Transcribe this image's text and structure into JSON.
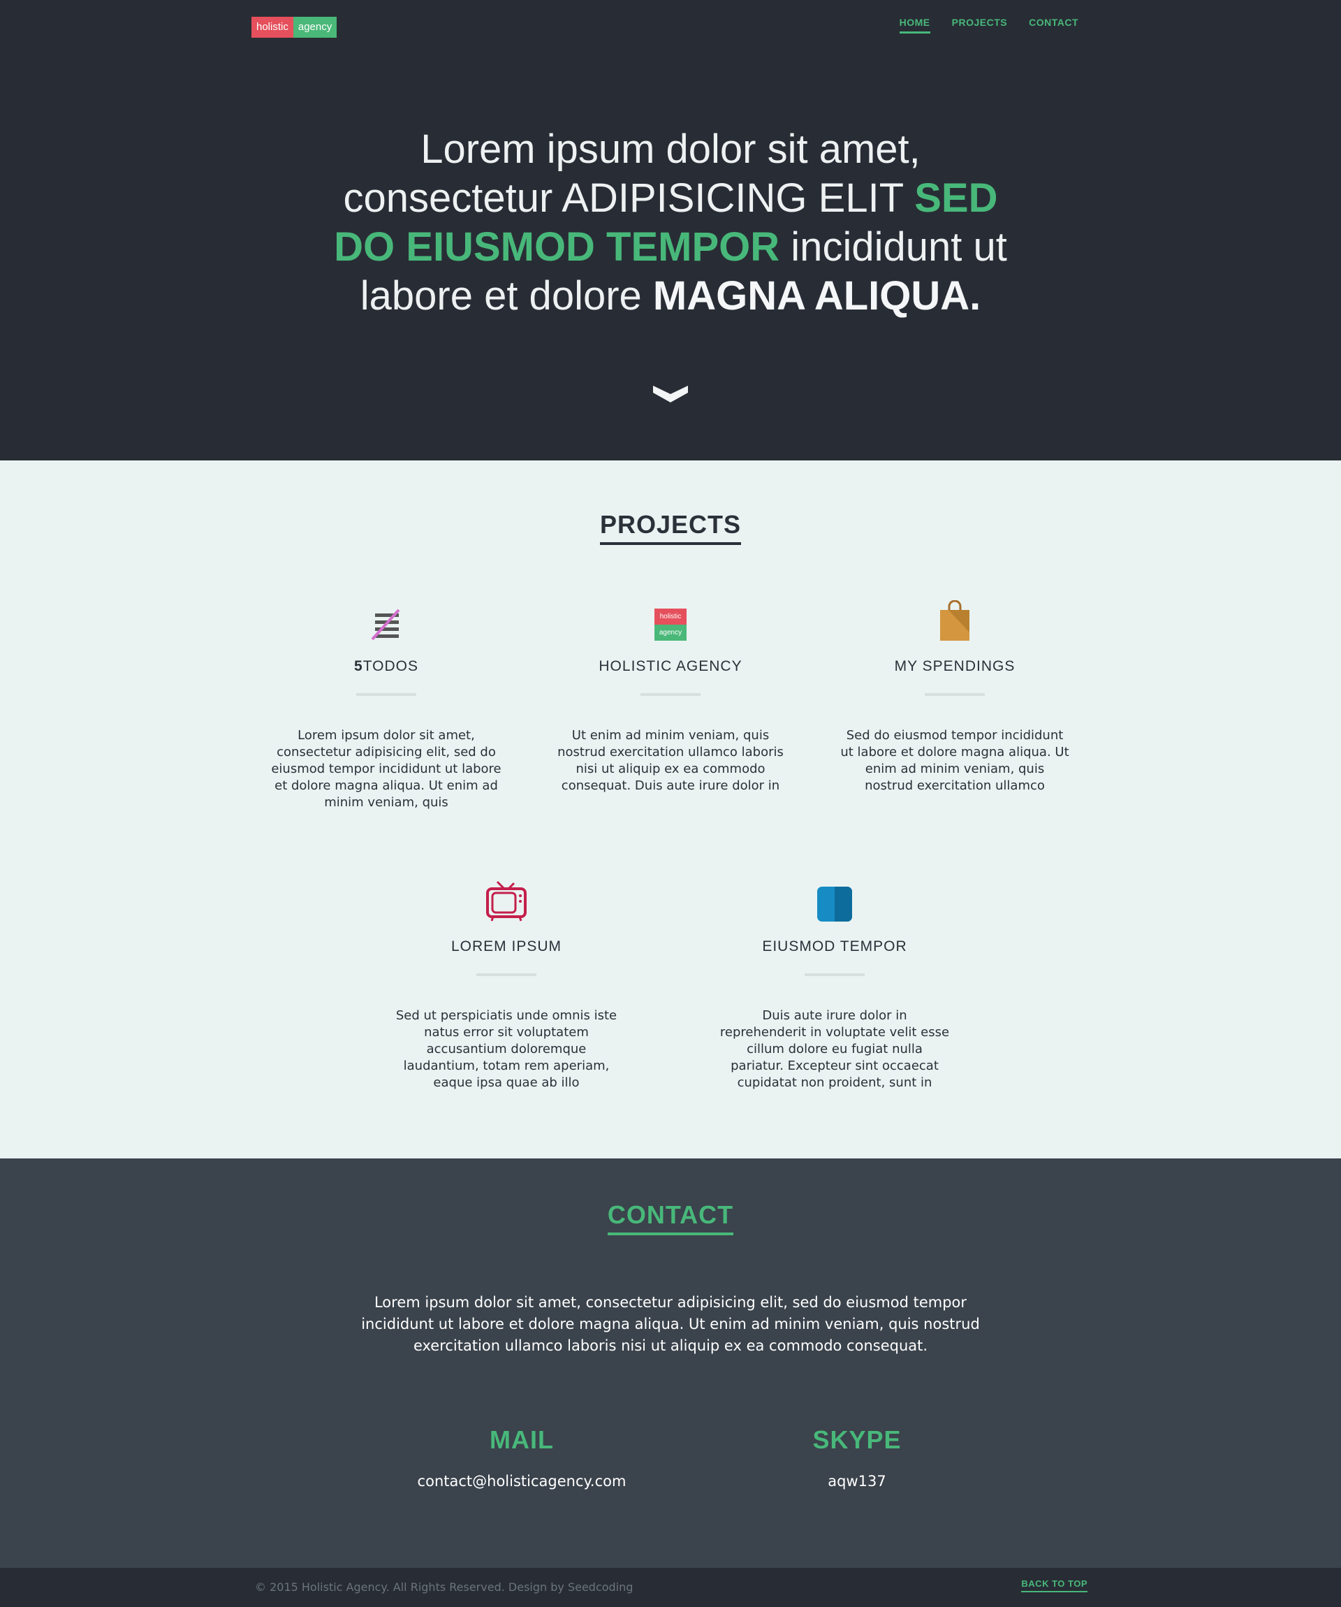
{
  "header": {
    "logo": {
      "part1": "holistic",
      "part2": "agency"
    },
    "nav": [
      {
        "label": "HOME"
      },
      {
        "label": "PROJECTS"
      },
      {
        "label": "CONTACT"
      }
    ]
  },
  "hero": {
    "line1": "Lorem ipsum dolor sit amet,",
    "line2_plain": "consectetur ADIPISICING ELIT",
    "line2_green": "SED",
    "line3_green": "DO EIUSMOD TEMPOR",
    "line3_plain": "incididunt ut",
    "line4_plain": "labore et dolore",
    "line4_bold": "MAGNA ALIQUA.",
    "scroll_icon": "chevron-down-icon"
  },
  "projects": {
    "title": "PROJECTS",
    "items": [
      {
        "name_prefix": "5",
        "name": "TODOS",
        "icon": "todo-list-icon",
        "desc": "Lorem ipsum dolor sit amet, consectetur adipisicing elit, sed do eiusmod tempor incididunt ut labore et dolore magna aliqua. Ut enim ad minim veniam, quis"
      },
      {
        "name_prefix": "",
        "name": "HOLISTIC AGENCY",
        "icon": "holistic-logo-icon",
        "icon_text1": "holistic",
        "icon_text2": "agency",
        "desc": "Ut enim ad minim veniam, quis nostrud exercitation ullamco laboris nisi ut aliquip ex ea commodo consequat. Duis aute irure dolor in"
      },
      {
        "name_prefix": "",
        "name": "MY SPENDINGS",
        "icon": "shopping-bag-icon",
        "desc": "Sed do eiusmod tempor incididunt ut labore et dolore magna aliqua. Ut enim ad minim veniam, quis nostrud exercitation ullamco"
      },
      {
        "name_prefix": "",
        "name": "LOREM IPSUM",
        "icon": "tv-icon",
        "desc": "Sed ut perspiciatis unde omnis iste natus error sit voluptatem accusantium doloremque laudantium, totam rem aperiam, eaque ipsa quae ab illo"
      },
      {
        "name_prefix": "",
        "name": "EIUSMOD TEMPOR",
        "icon": "book-icon",
        "desc": "Duis aute irure dolor in reprehenderit in voluptate velit esse cillum dolore eu fugiat nulla pariatur. Excepteur sint occaecat cupidatat non proident, sunt in"
      }
    ]
  },
  "contact": {
    "title": "CONTACT",
    "text": "Lorem ipsum dolor sit amet, consectetur adipisicing elit, sed do eiusmod tempor incididunt ut labore et dolore magna aliqua. Ut enim ad minim veniam, quis nostrud exercitation ullamco laboris nisi ut aliquip ex ea commodo consequat.",
    "mail_label": "MAIL",
    "mail_value": "contact@holisticagency.com",
    "skype_label": "SKYPE",
    "skype_value": "aqw137"
  },
  "footer": {
    "copyright": "© 2015 Holistic Agency. All Rights Reserved. Design by Seedcoding",
    "back_to_top": "BACK TO TOP"
  },
  "colors": {
    "dark_bg": "#282d35",
    "green_accent": "#48b87a",
    "logo_red": "#e5505c",
    "projects_bg": "#eaf3f2",
    "contact_bg": "#3b434c"
  }
}
